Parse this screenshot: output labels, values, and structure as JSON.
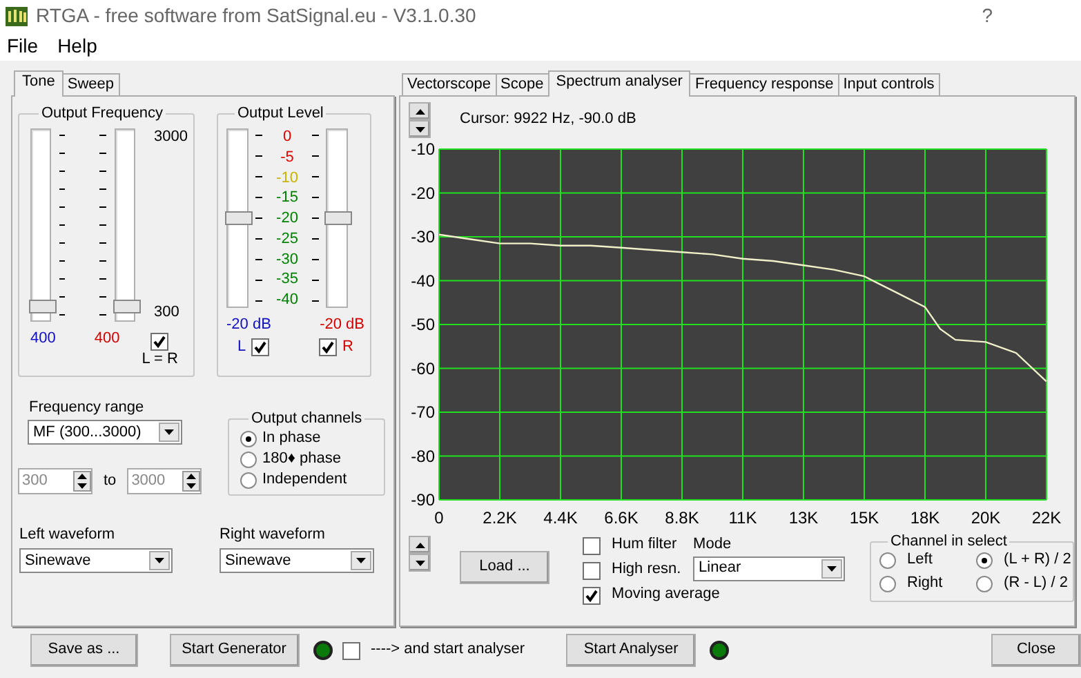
{
  "window": {
    "title": "RTGA  -  free software from SatSignal.eu  -  V3.1.0.30",
    "help": "?"
  },
  "menu": [
    {
      "label": "File"
    },
    {
      "label": "Help"
    }
  ],
  "left_tabs": [
    {
      "label": "Tone",
      "selected": true
    },
    {
      "label": "Sweep",
      "selected": false
    }
  ],
  "output_frequency": {
    "title": "Output Frequency",
    "max_label": "3000",
    "min_label": "300",
    "left": {
      "value": "400",
      "level": 0.04
    },
    "right": {
      "value": "400",
      "level": 0.04
    },
    "link": {
      "label": "L = R",
      "checked": true
    }
  },
  "output_level": {
    "title": "Output Level",
    "scale": [
      {
        "label": "0",
        "color": "#e00000"
      },
      {
        "label": "-5",
        "color": "#e00000"
      },
      {
        "label": "-10",
        "color": "#c8b400"
      },
      {
        "label": "-15",
        "color": "#008000"
      },
      {
        "label": "-20",
        "color": "#008000"
      },
      {
        "label": "-25",
        "color": "#008000"
      },
      {
        "label": "-30",
        "color": "#008000"
      },
      {
        "label": "-35",
        "color": "#008000"
      },
      {
        "label": "-40",
        "color": "#008000"
      }
    ],
    "left": {
      "value": "-20 dB",
      "level": 0.5,
      "label": "L",
      "checked": true
    },
    "right": {
      "value": "-20 dB",
      "level": 0.5,
      "label": "R",
      "checked": true
    }
  },
  "frequency_range": {
    "label": "Frequency range",
    "value": "MF  (300...3000)"
  },
  "range": {
    "from": "300",
    "to_label": "to",
    "to": "3000",
    "disabled": true
  },
  "output_channels": {
    "title": "Output channels",
    "options": [
      {
        "label": "In phase",
        "selected": true
      },
      {
        "label": "180♦ phase",
        "selected": false
      },
      {
        "label": "Independent",
        "selected": false
      }
    ]
  },
  "waveforms": [
    {
      "label": "Left waveform",
      "value": "Sinewave"
    },
    {
      "label": "Right waveform",
      "value": "Sinewave"
    }
  ],
  "right_tabs": [
    {
      "label": "Vectorscope",
      "selected": false
    },
    {
      "label": "Scope",
      "selected": false
    },
    {
      "label": "Spectrum analyser",
      "selected": true
    },
    {
      "label": "Frequency response",
      "selected": false
    },
    {
      "label": "Input controls",
      "selected": false
    }
  ],
  "cursor": "Cursor: 9922 Hz,  -90.0 dB",
  "chart_data": {
    "type": "line",
    "grid": true,
    "xlim": [
      0,
      22050
    ],
    "ylim": [
      -90,
      -10
    ],
    "yticks": [
      -10,
      -20,
      -30,
      -40,
      -50,
      -60,
      -70,
      -80,
      -90
    ],
    "xticks": [
      {
        "value": 0,
        "label": "0"
      },
      {
        "value": 2205,
        "label": "2.2K"
      },
      {
        "value": 4410,
        "label": "4.4K"
      },
      {
        "value": 6615,
        "label": "6.6K"
      },
      {
        "value": 8820,
        "label": "8.8K"
      },
      {
        "value": 11025,
        "label": "11K"
      },
      {
        "value": 13230,
        "label": "13K"
      },
      {
        "value": 15435,
        "label": "15K"
      },
      {
        "value": 17640,
        "label": "18K"
      },
      {
        "value": 19845,
        "label": "20K"
      },
      {
        "value": 22050,
        "label": "22K"
      }
    ],
    "x": [
      0,
      1102,
      2205,
      3307,
      4410,
      5512,
      6615,
      7717,
      8820,
      9922,
      11025,
      12127,
      13230,
      14332,
      15435,
      16537,
      17640,
      18190,
      18742,
      19845,
      20947,
      22050
    ],
    "series": [
      {
        "color": "#f0f0c8",
        "values": [
          -29.5,
          -30.5,
          -31.5,
          -31.5,
          -32,
          -32,
          -32.5,
          -33,
          -33.5,
          -34,
          -35,
          -35.5,
          -36.5,
          -37.5,
          -39,
          -42.5,
          -46,
          -51,
          -53.5,
          -54,
          -56.5,
          -63
        ]
      }
    ]
  },
  "load_button": "Load ...",
  "options": [
    {
      "label": "Hum filter",
      "checked": false
    },
    {
      "label": "High resn.",
      "checked": false
    },
    {
      "label": "Moving average",
      "checked": true
    }
  ],
  "mode": {
    "label": "Mode",
    "value": "Linear"
  },
  "channel_select": {
    "title": "Channel in select",
    "options": [
      {
        "label": "Left",
        "selected": false
      },
      {
        "label": "(L + R) / 2",
        "selected": true
      },
      {
        "label": "Right",
        "selected": false
      },
      {
        "label": "(R - L) / 2",
        "selected": false
      }
    ]
  },
  "bottom": {
    "save": "Save as ...",
    "start_generator": "Start Generator",
    "auto_start": {
      "label": "----> and start analyser",
      "checked": false
    },
    "start_analyser": "Start Analyser",
    "close": "Close"
  }
}
